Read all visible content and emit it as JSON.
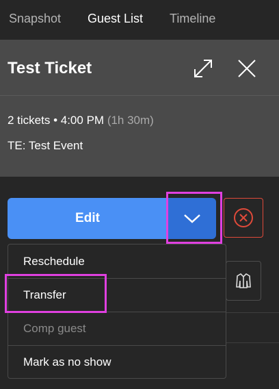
{
  "tabs": [
    {
      "label": "Snapshot",
      "active": false
    },
    {
      "label": "Guest List",
      "active": true
    },
    {
      "label": "Timeline",
      "active": false
    }
  ],
  "header": {
    "title": "Test Ticket"
  },
  "info": {
    "summary": "2 tickets • 4:00 PM",
    "duration": "(1h 30m)",
    "event": "TE: Test Event"
  },
  "actions": {
    "edit_label": "Edit"
  },
  "dropdown": {
    "items": [
      {
        "label": "Reschedule",
        "enabled": true
      },
      {
        "label": "Transfer",
        "enabled": true
      },
      {
        "label": "Comp guest",
        "enabled": false
      },
      {
        "label": "Mark as no show",
        "enabled": true
      }
    ]
  },
  "colors": {
    "primary": "#4a90f5",
    "primary_dark": "#2f6fd6",
    "danger": "#e04a3a",
    "highlight": "#e040e0"
  },
  "icons": {
    "expand": "expand-icon",
    "close": "close-icon",
    "chevron": "chevron-down-icon",
    "cancel": "cancel-circle-icon",
    "side": "jacket-icon"
  }
}
